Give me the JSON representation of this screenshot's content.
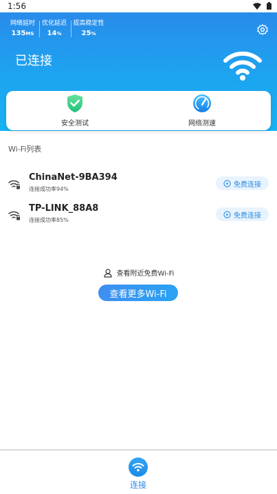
{
  "status_bar": {
    "time": "1:56"
  },
  "stats": [
    {
      "label": "网络延时",
      "value": "135",
      "unit": "MS"
    },
    {
      "label": "优化延迟",
      "value": "14",
      "unit": "%"
    },
    {
      "label": "提高稳定性",
      "value": "25",
      "unit": "%"
    }
  ],
  "connection": {
    "title": "已连接"
  },
  "tools": [
    {
      "label": "安全测试",
      "icon": "shield-check-icon"
    },
    {
      "label": "网络测速",
      "icon": "speedometer-icon"
    }
  ],
  "wifi_section": {
    "title": "Wi-Fi列表"
  },
  "wifi_list": [
    {
      "name": "ChinaNet-9BA394",
      "rate": "连接成功率94%",
      "action": "免费连接"
    },
    {
      "name": "TP-LINK_88A8",
      "rate": "连接成功率85%",
      "action": "免费连接"
    }
  ],
  "nearby": {
    "label": "查看附近免费Wi-Fi"
  },
  "more_button": {
    "label": "查看更多Wi-Fi"
  },
  "bottom_nav": {
    "items": [
      {
        "label": "连接",
        "icon": "wifi-icon"
      }
    ]
  },
  "colors": {
    "accent": "#2b8ce6",
    "header_start": "#2b86e8",
    "header_end": "#17b3f3"
  }
}
